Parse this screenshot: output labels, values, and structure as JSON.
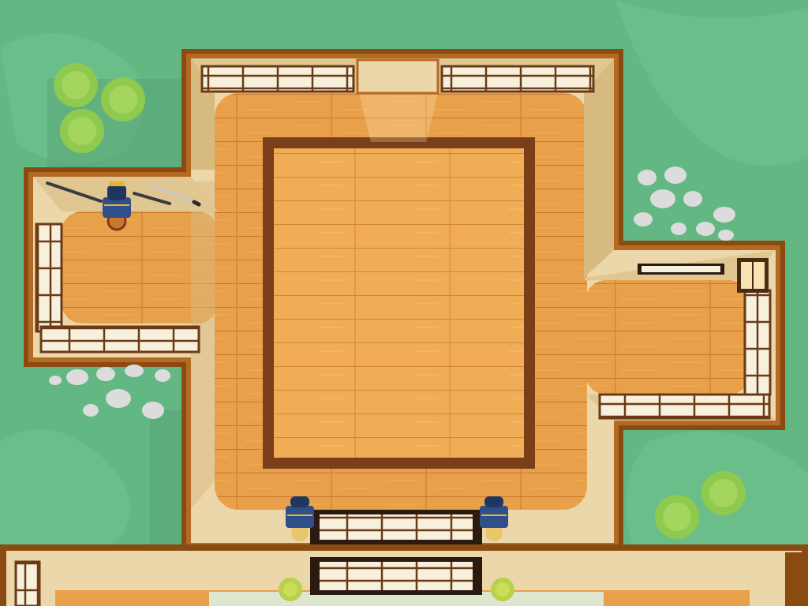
{
  "scene": {
    "type": "top-down dojo map",
    "colors": {
      "grass": "#62b783",
      "grass_light": "#6cc08d",
      "wall_outer": "#8a4b12",
      "wall_inner": "#ecd7aa",
      "floor": "#e39a44",
      "floor_light": "#f0ac52",
      "mat_border": "#7a3e18",
      "paper_screen": "#f6f0dc",
      "shrub": "#9bd055",
      "stone": "#dcdcdc",
      "armor_blue": "#2e4f8a",
      "armor_gold": "#e8b62a"
    },
    "rooms": [
      {
        "name": "main-hall"
      },
      {
        "name": "west-armory"
      },
      {
        "name": "east-shrine"
      },
      {
        "name": "south-corridor"
      }
    ],
    "objects": [
      {
        "name": "samurai-armor",
        "count": 3
      },
      {
        "name": "katana-rack",
        "count": 1
      },
      {
        "name": "paper-lantern",
        "count": 2
      },
      {
        "name": "shrub",
        "count": 5
      },
      {
        "name": "potted-bonsai",
        "count": 2
      },
      {
        "name": "stepping-stones",
        "count": 2
      }
    ]
  }
}
